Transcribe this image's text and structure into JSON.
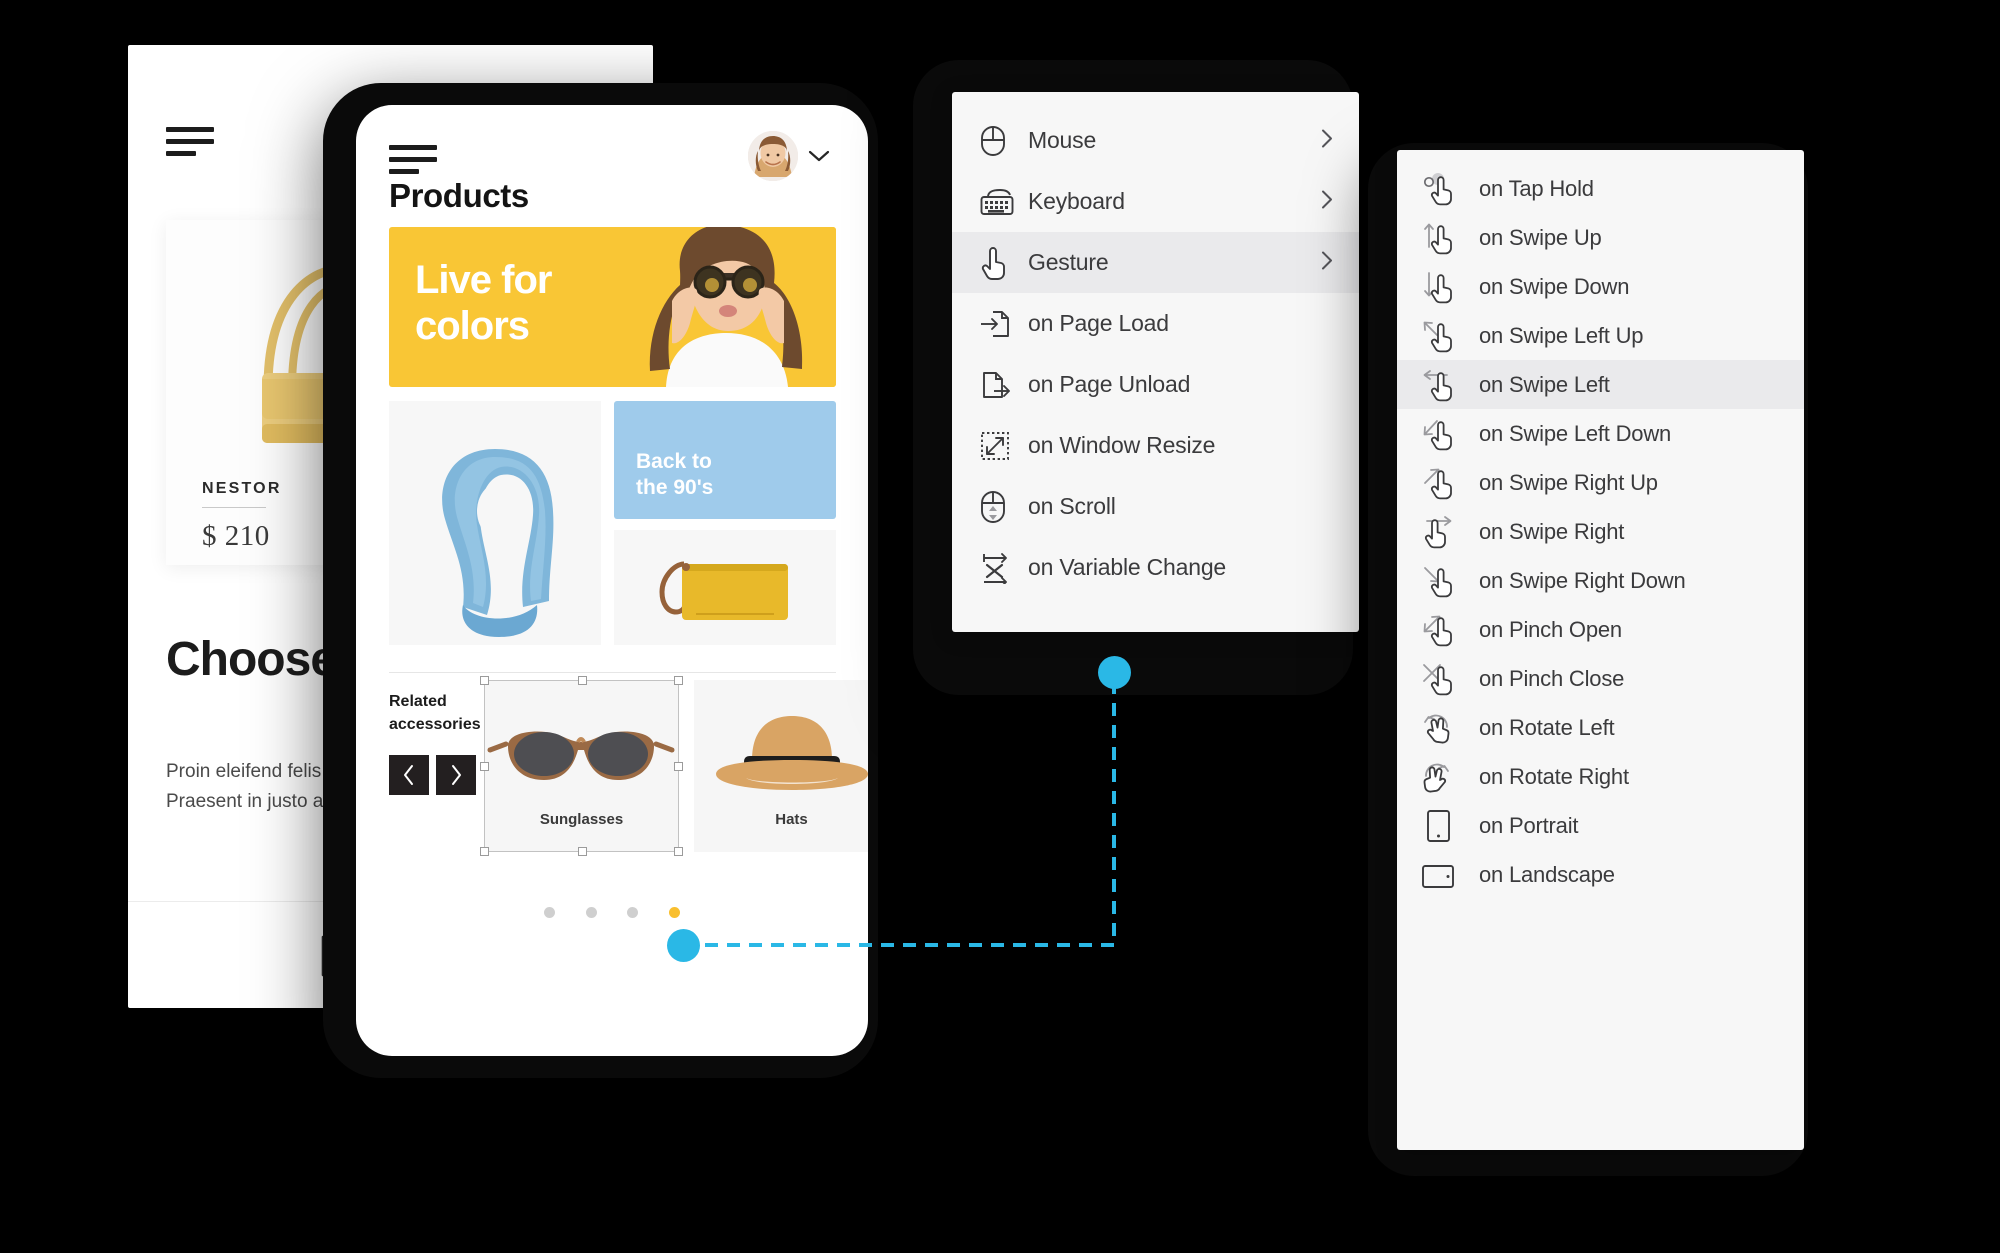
{
  "back_phone": {
    "icons": {
      "menu": "hamburger-icon",
      "search": "search-icon",
      "bag": "shopping-bag-icon",
      "bookmark": "bookmark-icon",
      "nav_menu": "hamburger-icon"
    },
    "product": {
      "brand": "NESTOR",
      "price": "$ 210"
    },
    "heading": "Choose steps",
    "body": "Proin eleifend felis\nPraesent in justo a"
  },
  "front_phone": {
    "title": "Products",
    "avatar_alt": "user-avatar",
    "hero": {
      "line1": "Live for",
      "line2": "colors",
      "bg": "#f9c635"
    },
    "blue_card": {
      "line1": "Back to",
      "line2": "the 90's",
      "bg": "#9fcbeb"
    },
    "related": {
      "label": "Related accessories",
      "prev": "‹",
      "next": "›"
    },
    "cards": [
      {
        "caption": "Sunglasses",
        "selected": true
      },
      {
        "caption": "Hats",
        "selected": false
      }
    ],
    "pagination": {
      "count": 4,
      "active_index": 3,
      "active_color": "#f9bf2e",
      "inactive_color": "#cfcfcf"
    }
  },
  "events_menu": {
    "items": [
      {
        "label": "Mouse",
        "icon": "mouse-icon",
        "has_submenu": true,
        "highlight": false
      },
      {
        "label": "Keyboard",
        "icon": "keyboard-icon",
        "has_submenu": true,
        "highlight": false
      },
      {
        "label": "Gesture",
        "icon": "hand-pointer-icon",
        "has_submenu": true,
        "highlight": true
      },
      {
        "label": "on Page Load",
        "icon": "page-load-icon",
        "has_submenu": false,
        "highlight": false
      },
      {
        "label": "on Page Unload",
        "icon": "page-unload-icon",
        "has_submenu": false,
        "highlight": false
      },
      {
        "label": "on Window Resize",
        "icon": "window-resize-icon",
        "has_submenu": false,
        "highlight": false
      },
      {
        "label": "on Scroll",
        "icon": "mouse-scroll-icon",
        "has_submenu": false,
        "highlight": false
      },
      {
        "label": "on Variable Change",
        "icon": "variable-change-icon",
        "has_submenu": false,
        "highlight": false
      }
    ]
  },
  "gesture_menu": {
    "items": [
      {
        "label": "on Tap Hold",
        "icon": "tap-hold-icon",
        "highlight": false
      },
      {
        "label": "on Swipe Up",
        "icon": "swipe-up-icon",
        "highlight": false
      },
      {
        "label": "on Swipe Down",
        "icon": "swipe-down-icon",
        "highlight": false
      },
      {
        "label": "on Swipe Left Up",
        "icon": "swipe-left-up-icon",
        "highlight": false
      },
      {
        "label": "on Swipe Left",
        "icon": "swipe-left-icon",
        "highlight": true
      },
      {
        "label": "on Swipe Left Down",
        "icon": "swipe-left-down-icon",
        "highlight": false
      },
      {
        "label": "on Swipe Right Up",
        "icon": "swipe-right-up-icon",
        "highlight": false
      },
      {
        "label": "on Swipe Right",
        "icon": "swipe-right-icon",
        "highlight": false
      },
      {
        "label": "on Swipe Right Down",
        "icon": "swipe-right-down-icon",
        "highlight": false
      },
      {
        "label": "on Pinch Open",
        "icon": "pinch-open-icon",
        "highlight": false
      },
      {
        "label": "on Pinch Close",
        "icon": "pinch-close-icon",
        "highlight": false
      },
      {
        "label": "on Rotate Left",
        "icon": "rotate-left-icon",
        "highlight": false
      },
      {
        "label": "on Rotate Right",
        "icon": "rotate-right-icon",
        "highlight": false
      },
      {
        "label": "on Portrait",
        "icon": "portrait-icon",
        "highlight": false
      },
      {
        "label": "on Landscape",
        "icon": "landscape-icon",
        "highlight": false
      }
    ]
  },
  "connector": {
    "color": "#2ab8e6",
    "style": "dashed"
  }
}
